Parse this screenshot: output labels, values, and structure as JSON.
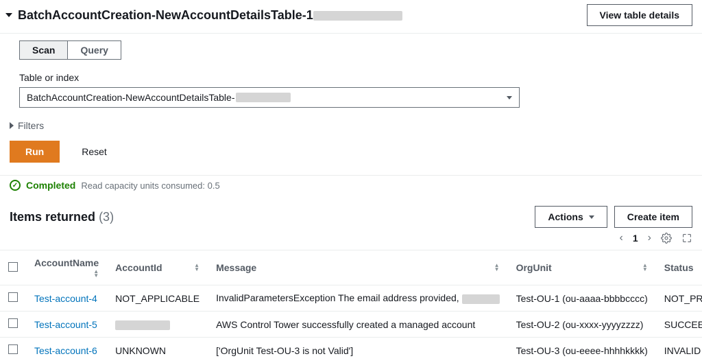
{
  "header": {
    "title_prefix": "BatchAccountCreation-NewAccountDetailsTable-1",
    "view_details_label": "View table details"
  },
  "tabs": {
    "scan": "Scan",
    "query": "Query"
  },
  "form": {
    "table_label": "Table or index",
    "select_value_prefix": "BatchAccountCreation-NewAccountDetailsTable-",
    "filters_label": "Filters"
  },
  "actions": {
    "run": "Run",
    "reset": "Reset"
  },
  "status": {
    "state": "Completed",
    "capacity": "Read capacity units consumed: 0.5"
  },
  "items": {
    "title": "Items returned",
    "count": "(3)",
    "actions_label": "Actions",
    "create_label": "Create item",
    "page": "1"
  },
  "columns": {
    "name": "AccountName",
    "id": "AccountId",
    "msg": "Message",
    "org": "OrgUnit",
    "status": "Status"
  },
  "rows": [
    {
      "name": "Test-account-4",
      "id": "NOT_APPLICABLE",
      "id_redacted": false,
      "msg": "InvalidParametersException The email address provided,",
      "msg_trailing_redact": true,
      "org": "Test-OU-1 (ou-aaaa-bbbbcccc)",
      "status": "NOT_PROVISIONED"
    },
    {
      "name": "Test-account-5",
      "id": "",
      "id_redacted": true,
      "msg": "AWS Control Tower successfully created a managed account",
      "msg_trailing_redact": false,
      "org": "Test-OU-2 (ou-xxxx-yyyyzzzz)",
      "status": "SUCCEEDED"
    },
    {
      "name": "Test-account-6",
      "id": "UNKNOWN",
      "id_redacted": false,
      "msg": "['OrgUnit Test-OU-3 is not Valid']",
      "msg_trailing_redact": false,
      "org": "Test-OU-3 (ou-eeee-hhhhkkkk)",
      "status": "INVALID"
    }
  ]
}
